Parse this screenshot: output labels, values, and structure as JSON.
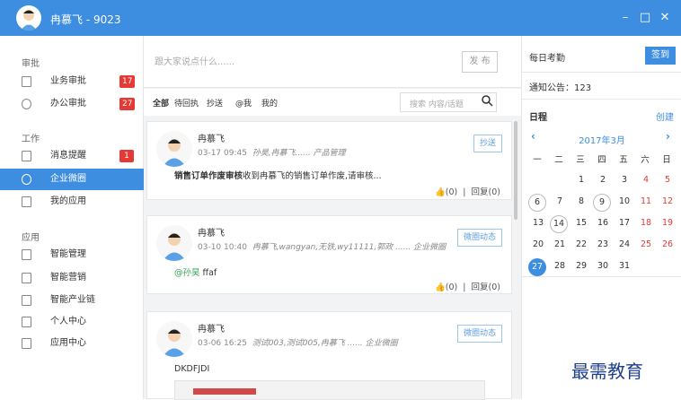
{
  "window": {
    "title": "冉慕飞 - 9023",
    "controls": [
      "–",
      "□",
      "✕"
    ]
  },
  "sidebar": {
    "sections": [
      {
        "label": "审批",
        "items": [
          {
            "label": "业务审批",
            "badge": "17",
            "icon": "document-icon"
          },
          {
            "label": "办公审批",
            "badge": "27",
            "icon": "check-circle-icon"
          }
        ]
      },
      {
        "label": "工作",
        "items": [
          {
            "label": "消息提醒",
            "badge": "1",
            "icon": "message-icon"
          },
          {
            "label": "企业微圈",
            "badge": "",
            "icon": "circle-icon",
            "active": true
          },
          {
            "label": "我的应用",
            "badge": "",
            "icon": "apps-grid-icon"
          }
        ]
      },
      {
        "label": "应用",
        "items": [
          {
            "label": "智能管理",
            "badge": "",
            "icon": "bracket-icon"
          },
          {
            "label": "智能营销",
            "badge": "",
            "icon": "document-icon"
          },
          {
            "label": "智能产业链",
            "badge": "",
            "icon": "document-icon"
          },
          {
            "label": "个人中心",
            "badge": "",
            "icon": "document-icon"
          },
          {
            "label": "应用中心",
            "badge": "",
            "icon": "list-icon"
          }
        ]
      }
    ]
  },
  "composer": {
    "placeholder": "跟大家说点什么......",
    "publish": "发 布"
  },
  "filters": {
    "tabs": [
      "全部",
      "待回执",
      "抄送",
      "@我",
      "我的"
    ],
    "search_placeholder": "搜索 内容/话题"
  },
  "posts": [
    {
      "author": "冉慕飞",
      "time": "03-17 09:45",
      "meta": "孙昊,冉慕飞...... 产品管理",
      "tag": "抄送",
      "body_bold": "销售订单作废审核",
      "body": "收到冉慕飞的销售订单作废,请审核...",
      "likes": "(0)",
      "reply": "回复(0)"
    },
    {
      "author": "冉慕飞",
      "time": "03-10 10:40",
      "meta": "冉慕飞,wangyan,无铁,wy11111,郭政 ...... 企业微圈",
      "tag": "微圈动态",
      "mention": "@孙昊",
      "body": " ffaf",
      "likes": "(0)",
      "reply": "回复(0)"
    },
    {
      "author": "冉慕飞",
      "time": "03-06 16:25",
      "meta": "测试003,测试005,冉慕飞 ...... 企业微圈",
      "tag": "微圈动态",
      "body": "DKDFJDI"
    }
  ],
  "right_panel": {
    "checkin_title": "每日考勤",
    "checkin_button": "签到",
    "notice": "通知公告：123",
    "schedule_title": "日程",
    "create": "创建",
    "calendar": {
      "month": "2017年3月",
      "weekdays": [
        "一",
        "二",
        "三",
        "四",
        "五",
        "六",
        "日"
      ],
      "weeks": [
        [
          "",
          "",
          "1",
          "2",
          "3",
          "4",
          "5"
        ],
        [
          "6",
          "7",
          "8",
          "9",
          "10",
          "11",
          "12"
        ],
        [
          "13",
          "14",
          "15",
          "16",
          "17",
          "18",
          "19"
        ],
        [
          "20",
          "21",
          "22",
          "23",
          "24",
          "25",
          "26"
        ],
        [
          "27",
          "28",
          "29",
          "30",
          "31",
          "",
          ""
        ]
      ],
      "circled": [
        "6",
        "9",
        "14"
      ],
      "today": "27",
      "weekend_color": "#e53935",
      "accent": "#3d8de0"
    }
  },
  "watermark": "最需教育"
}
